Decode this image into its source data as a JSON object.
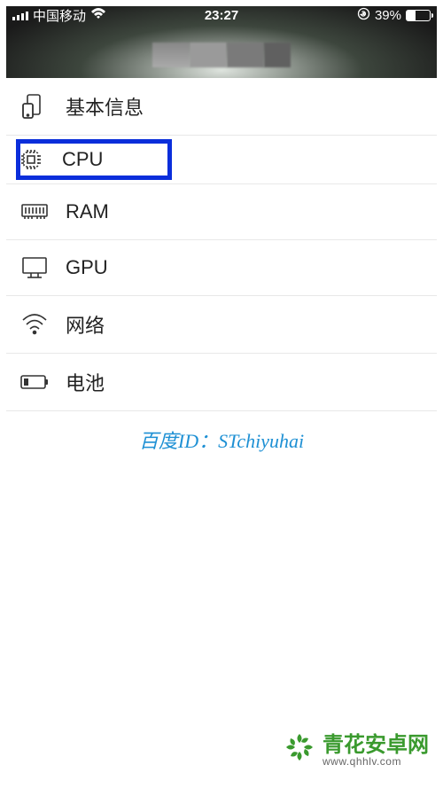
{
  "status_bar": {
    "carrier": "中国移动",
    "time": "23:27",
    "battery_percent": "39%",
    "battery_fill_pct": 39
  },
  "menu": {
    "items": [
      {
        "id": "basic-info",
        "label": "基本信息",
        "highlighted": false
      },
      {
        "id": "cpu",
        "label": "CPU",
        "highlighted": true
      },
      {
        "id": "ram",
        "label": "RAM",
        "highlighted": false
      },
      {
        "id": "gpu",
        "label": "GPU",
        "highlighted": false
      },
      {
        "id": "network",
        "label": "网络",
        "highlighted": false
      },
      {
        "id": "battery",
        "label": "电池",
        "highlighted": false
      }
    ]
  },
  "watermark": "百度ID：STchiyuhai",
  "footer": {
    "brand": "青花安卓网",
    "url": "www.qhhlv.com"
  }
}
